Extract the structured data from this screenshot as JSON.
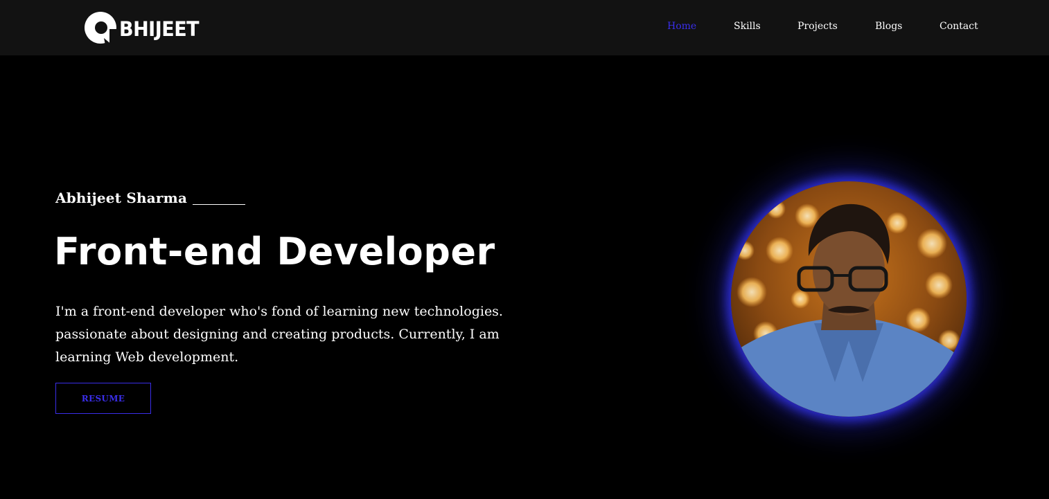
{
  "brand": {
    "logo_text": "BHIJEET",
    "logo_icon": "letter-a-logo-icon"
  },
  "nav": {
    "items": [
      {
        "label": "Home",
        "active": true
      },
      {
        "label": "Skills",
        "active": false
      },
      {
        "label": "Projects",
        "active": false
      },
      {
        "label": "Blogs",
        "active": false
      },
      {
        "label": "Contact",
        "active": false
      }
    ]
  },
  "hero": {
    "name": "Abhijeet Sharma",
    "title": "Front-end Developer",
    "bio": "I'm a front-end developer who's fond of learning new technologies. passionate about designing and creating products. Currently, I am learning Web development.",
    "cta_label": "RESUME"
  },
  "colors": {
    "background": "#000000",
    "navbar": "#121212",
    "accent": "#3a2eea",
    "text": "#ffffff"
  }
}
